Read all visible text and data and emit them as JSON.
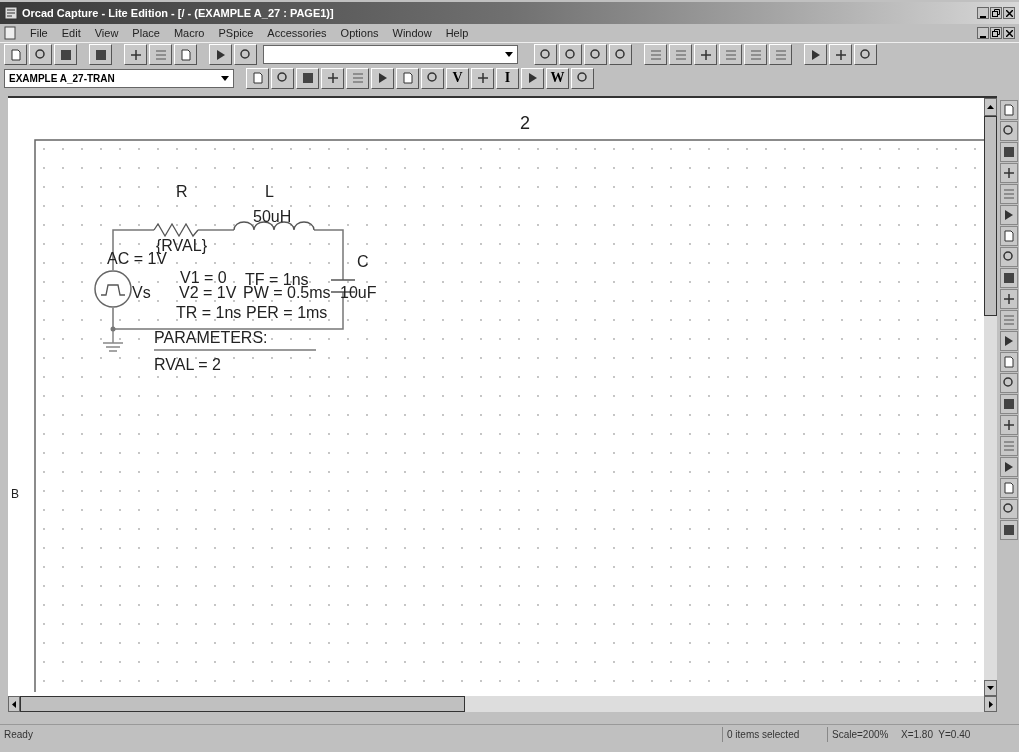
{
  "window": {
    "title": "Orcad Capture - Lite Edition - [/ - (EXAMPLE A_27 : PAGE1)]"
  },
  "menu": [
    "File",
    "Edit",
    "View",
    "Place",
    "Macro",
    "PSpice",
    "Accessories",
    "Options",
    "Window",
    "Help"
  ],
  "toolbar_2": {
    "profile": "EXAMPLE A_27-TRAN",
    "buttons": [
      {
        "kind": "icon"
      },
      {
        "kind": "icon"
      },
      {
        "kind": "icon"
      },
      {
        "kind": "icon"
      },
      {
        "kind": "icon"
      },
      {
        "kind": "icon"
      },
      {
        "kind": "icon"
      },
      {
        "kind": "icon"
      },
      {
        "kind": "text",
        "label": "V"
      },
      {
        "kind": "icon"
      },
      {
        "kind": "text",
        "label": "I"
      },
      {
        "kind": "icon"
      },
      {
        "kind": "text",
        "label": "W"
      },
      {
        "kind": "icon"
      }
    ]
  },
  "page": {
    "column_label": "2",
    "row_label": "B"
  },
  "schematic": {
    "parts": [
      {
        "kind": "resistor",
        "ref": "R",
        "value": "{RVAL}"
      },
      {
        "kind": "inductor",
        "ref": "L",
        "value": "50uH"
      },
      {
        "kind": "capacitor",
        "ref": "C",
        "value": "10uF"
      },
      {
        "kind": "vpulse",
        "ref": "Vs",
        "ac": "AC = 1V",
        "params": [
          "V1 = 0",
          "TF = 1ns",
          "V2 = 1V",
          "PW = 0.5ms",
          "TR = 1ns",
          "PER = 1ms"
        ]
      },
      {
        "kind": "param",
        "title": "PARAMETERS:",
        "values": [
          "RVAL = 2"
        ]
      }
    ]
  },
  "status_bar": {
    "message": "Ready",
    "selection": "0 items selected",
    "scale": "Scale=200%",
    "coords": "X=1.80  Y=0.40"
  }
}
